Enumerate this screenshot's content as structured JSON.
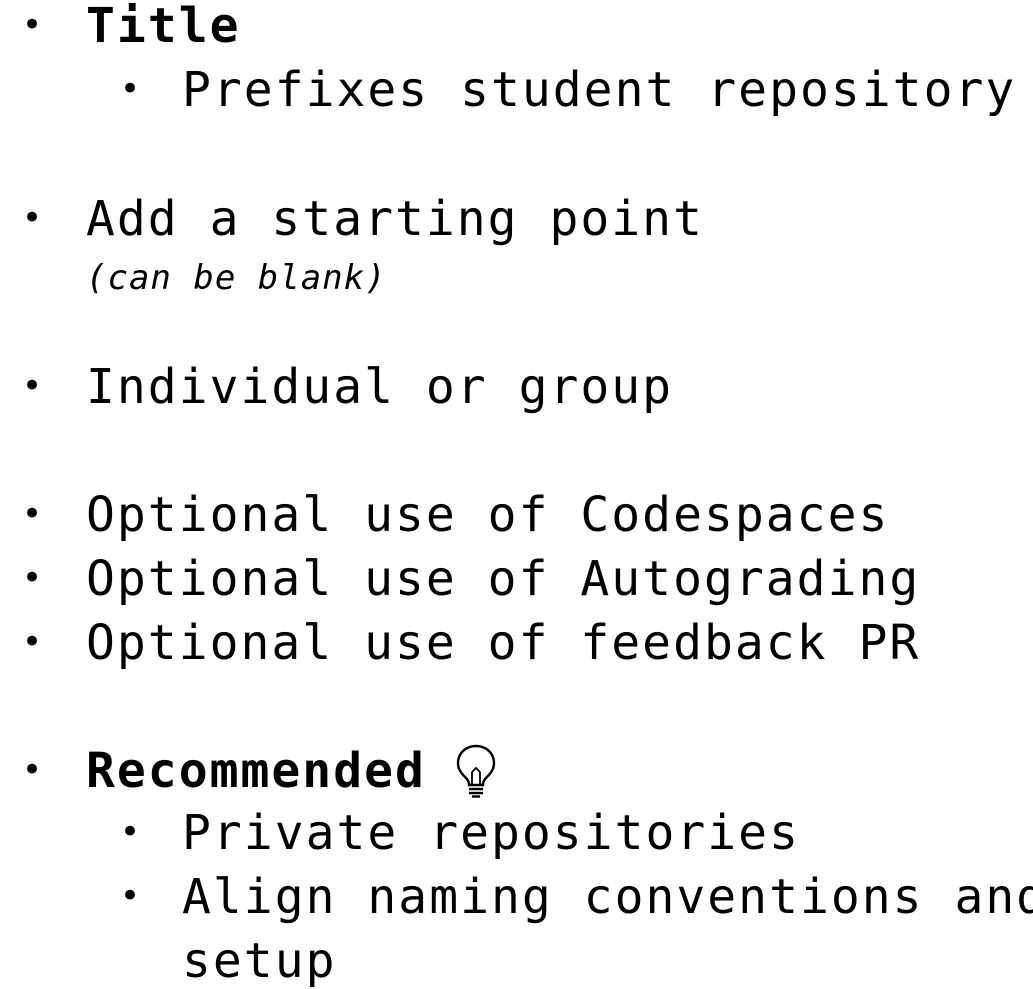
{
  "items": {
    "title": {
      "label": "Title",
      "sub": [
        "Prefixes student repository"
      ]
    },
    "starting_point": {
      "label": "Add a starting point",
      "note": "(can be blank)"
    },
    "individual_group": {
      "label": "Individual or group"
    },
    "optional": [
      "Optional use of Codespaces",
      "Optional use of Autograding",
      "Optional use of feedback PR"
    ],
    "recommended": {
      "label": "Recommended",
      "icon": "lightbulb-icon",
      "sub": [
        "Private repositories",
        "Align naming conventions and",
        "setup"
      ]
    }
  }
}
